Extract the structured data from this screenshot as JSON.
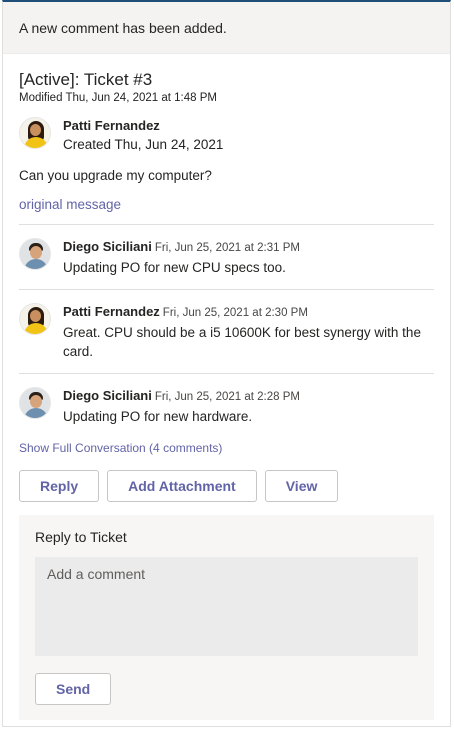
{
  "banner": {
    "text": "A new comment has been added."
  },
  "ticket": {
    "title": "[Active]: Ticket #3",
    "modified": "Modified Thu, Jun 24, 2021 at 1:48 PM",
    "creator": {
      "name": "Patti Fernandez",
      "created": "Created Thu, Jun 24, 2021"
    },
    "question": "Can you upgrade my computer?",
    "original_link": "original message"
  },
  "comments": [
    {
      "author": "Diego Siciliani",
      "time": "Fri, Jun 25, 2021 at 2:31 PM",
      "text": "Updating PO for new CPU specs too."
    },
    {
      "author": "Patti Fernandez",
      "time": "Fri, Jun 25, 2021 at 2:30 PM",
      "text": "Great. CPU should be a i5 10600K for best synergy with the card."
    },
    {
      "author": "Diego Siciliani",
      "time": "Fri, Jun 25, 2021 at 2:28 PM",
      "text": "Updating PO for new hardware."
    }
  ],
  "show_full": "Show Full Conversation (4 comments)",
  "actions": {
    "reply": "Reply",
    "attach": "Add Attachment",
    "view": "View"
  },
  "reply_panel": {
    "title": "Reply to Ticket",
    "placeholder": "Add a comment",
    "send": "Send"
  },
  "colors": {
    "accent": "#6264a7",
    "top_border": "#1f4e79",
    "banner_bg": "#f5f3f2",
    "panel_bg": "#f8f6f4"
  },
  "icons": {
    "patti_avatar": "avatar-patti-fernandez",
    "diego_avatar": "avatar-diego-siciliani"
  }
}
